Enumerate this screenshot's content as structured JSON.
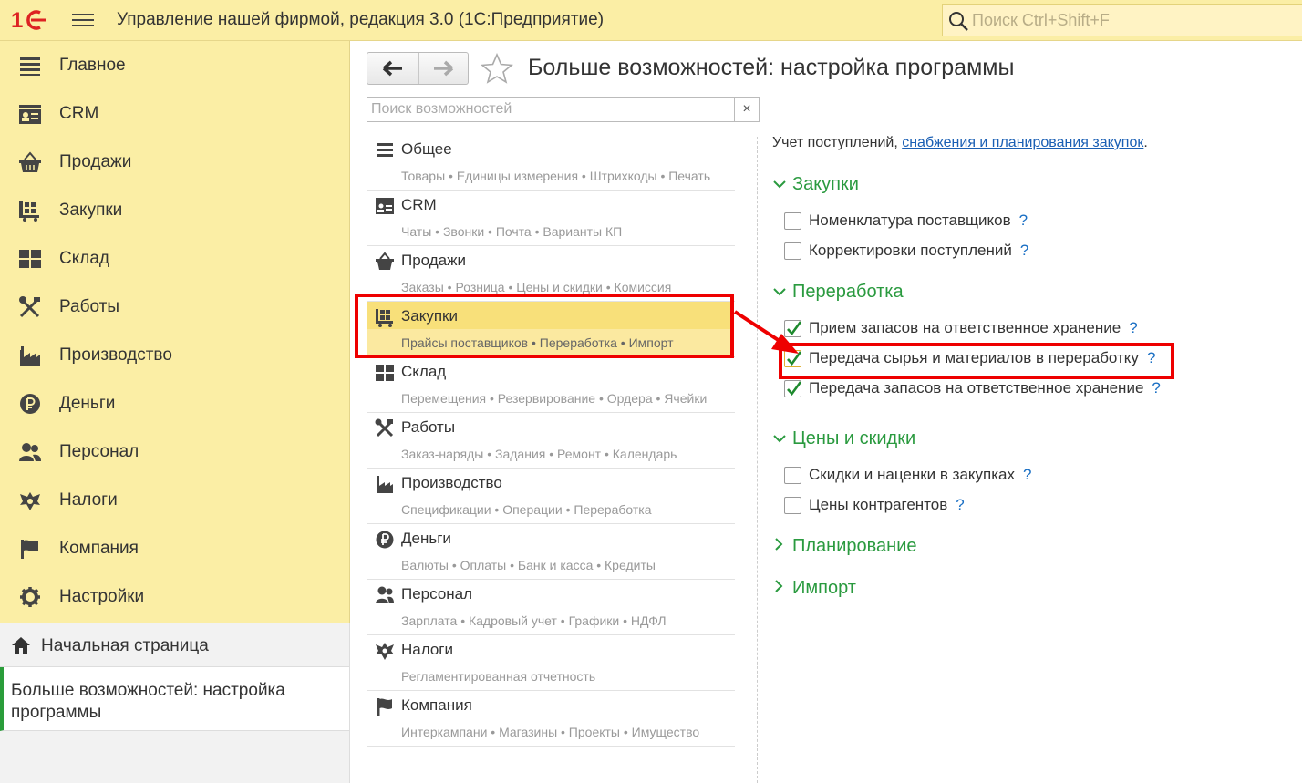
{
  "app": {
    "title": "Управление нашей фирмой, редакция 3.0  (1С:Предприятие)",
    "search_placeholder": "Поиск Ctrl+Shift+F"
  },
  "sidebar": {
    "items": [
      {
        "label": "Главное",
        "icon": "menu-list-icon"
      },
      {
        "label": "CRM",
        "icon": "contact-card-icon"
      },
      {
        "label": "Продажи",
        "icon": "basket-icon"
      },
      {
        "label": "Закупки",
        "icon": "cart-icon"
      },
      {
        "label": "Склад",
        "icon": "warehouse-grid-icon"
      },
      {
        "label": "Работы",
        "icon": "tools-icon"
      },
      {
        "label": "Производство",
        "icon": "factory-icon"
      },
      {
        "label": "Деньги",
        "icon": "ruble-icon"
      },
      {
        "label": "Персонал",
        "icon": "people-icon"
      },
      {
        "label": "Налоги",
        "icon": "eagle-emblem-icon"
      },
      {
        "label": "Компания",
        "icon": "flag-icon"
      },
      {
        "label": "Настройки",
        "icon": "gear-icon"
      }
    ],
    "home": "Начальная страница",
    "open_window": "Больше возможностей: настройка программы"
  },
  "main": {
    "title": "Больше возможностей: настройка программы",
    "search_placeholder": "Поиск возможностей",
    "clear_label": "×",
    "sections": [
      {
        "name": "Общее",
        "sub": "Товары • Единицы измерения • Штрихкоды • Печать"
      },
      {
        "name": "CRM",
        "sub": "Чаты • Звонки • Почта • Варианты КП"
      },
      {
        "name": "Продажи",
        "sub": "Заказы • Розница • Цены и скидки • Комиссия"
      },
      {
        "name": "Закупки",
        "sub": "Прайсы поставщиков • Переработка • Импорт"
      },
      {
        "name": "Склад",
        "sub": "Перемещения • Резервирование • Ордера • Ячейки"
      },
      {
        "name": "Работы",
        "sub": "Заказ-наряды • Задания • Ремонт • Календарь"
      },
      {
        "name": "Производство",
        "sub": "Спецификации • Операции • Переработка"
      },
      {
        "name": "Деньги",
        "sub": "Валюты • Оплаты • Банк и касса • Кредиты"
      },
      {
        "name": "Персонал",
        "sub": "Зарплата • Кадровый учет • Графики • НДФЛ"
      },
      {
        "name": "Налоги",
        "sub": "Регламентированная отчетность"
      },
      {
        "name": "Компания",
        "sub": "Интеркампани • Магазины • Проекты • Имущество"
      }
    ],
    "selected_section": "Закупки"
  },
  "settings": {
    "intro_text": "Учет поступлений, ",
    "intro_link": "снабжения и планирования закупок",
    "intro_end": ".",
    "help": "?",
    "groups": {
      "purchases": {
        "title": "Закупки",
        "options": [
          {
            "label": "Номенклатура поставщиков",
            "checked": false
          },
          {
            "label": "Корректировки поступлений",
            "checked": false
          }
        ]
      },
      "processing": {
        "title": "Переработка",
        "options": [
          {
            "label": "Прием запасов на ответственное хранение",
            "checked": true
          },
          {
            "label": "Передача сырья и материалов в переработку",
            "checked": true
          },
          {
            "label": "Передача запасов на ответственное хранение",
            "checked": true
          }
        ]
      },
      "prices": {
        "title": "Цены и скидки",
        "options": [
          {
            "label": "Скидки и наценки в закупках",
            "checked": false
          },
          {
            "label": "Цены контрагентов",
            "checked": false
          }
        ]
      },
      "planning": {
        "title": "Планирование"
      },
      "import": {
        "title": "Импорт"
      }
    }
  },
  "colors": {
    "sidebar_bg": "#fbeea5",
    "accent_green": "#2a9a3f",
    "link_blue": "#1a5fb4",
    "highlight_red": "#e00000"
  }
}
